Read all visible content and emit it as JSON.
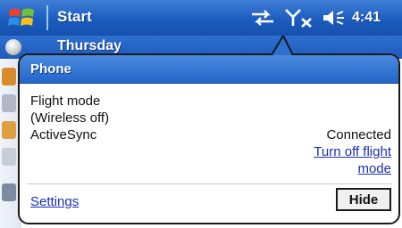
{
  "titlebar": {
    "start_label": "Start",
    "time": "4:41",
    "icons": [
      "windows-flag-icon",
      "activesync-arrows-icon",
      "antenna-off-icon",
      "speaker-icon"
    ]
  },
  "today": {
    "day": "Thursday"
  },
  "notification": {
    "title": "Phone",
    "line1": "Flight mode",
    "line2": "(Wireless off)",
    "activesync_label": "ActiveSync",
    "activesync_status": "Connected",
    "turn_off_link_line1": "Turn off flight",
    "turn_off_link_line2": "mode",
    "settings_link": "Settings",
    "hide_button": "Hide"
  },
  "colors": {
    "titlebar": "#1c5cc0",
    "link": "#1a2fb0"
  }
}
